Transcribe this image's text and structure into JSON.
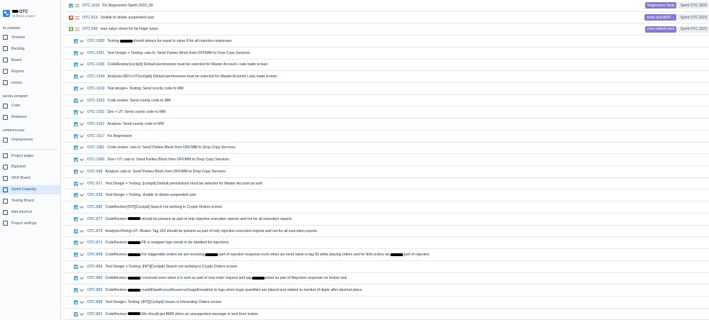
{
  "project": {
    "name": "OTC",
    "type": "Software project"
  },
  "sidebar": {
    "sections": {
      "planning": "PLANNING",
      "development": "DEVELOPMENT",
      "operations": "OPERATIONS"
    },
    "planning": [
      {
        "label": "Timeline",
        "icon": "timeline-icon"
      },
      {
        "label": "Backlog",
        "icon": "backlog-icon"
      },
      {
        "label": "Board",
        "icon": "board-icon"
      },
      {
        "label": "Reports",
        "icon": "reports-icon"
      },
      {
        "label": "Issues",
        "icon": "issues-icon"
      }
    ],
    "development": [
      {
        "label": "Code",
        "icon": "code-icon"
      },
      {
        "label": "Releases",
        "icon": "releases-icon"
      }
    ],
    "operations": [
      {
        "label": "Deployments",
        "icon": "deployments-icon"
      }
    ],
    "apps": [
      {
        "label": "Project pages",
        "icon": "pages-icon"
      },
      {
        "label": "BigGantt",
        "icon": "biggantt-icon"
      },
      {
        "label": "OKR Board",
        "icon": "okr-icon"
      },
      {
        "label": "Sprint Capacity",
        "icon": "capacity-icon",
        "active": true
      },
      {
        "label": "Testing Board",
        "icon": "testing-icon"
      },
      {
        "label": "Add shortcut",
        "icon": "add-icon"
      },
      {
        "label": "Project settings",
        "icon": "settings-icon"
      }
    ]
  },
  "issues": [
    {
      "type": "task",
      "key": "OTC-1016",
      "summary": "Fix Regression Sprint 2023_09",
      "label": "Regression Tests",
      "sprint": "Sprint OTC 2023"
    },
    {
      "type": "bug",
      "key": "OTC-913",
      "summary": "Unable to delete suspended user",
      "label": "trade and MDP ...",
      "sprint": "Sprint OTC 2023"
    },
    {
      "type": "story",
      "key": "OTC-246",
      "summary": "max value check for fat finger typos",
      "label": "core related work",
      "sprint": "Sprint OTC 2023"
    },
    {
      "type": "sub",
      "key": "OTC-1052",
      "summary_parts": [
        "Testing",
        "should always be equal to value 8 for all rejection responses."
      ]
    },
    {
      "type": "sub",
      "key": "OTC-1051",
      "summary": "Test Design + Testing: cats-ls: Send Parties Block from OFF/MM to Drop Copy Services"
    },
    {
      "type": "sub",
      "key": "OTC-1035",
      "summary": "CodeReview:[cockpit] Default permissions must be selected for Master Account i cats trade screen"
    },
    {
      "type": "sub",
      "key": "OTC-1034",
      "summary": "Analysis+DEV+UT:[cockpit] Default permissions must be selected for Master Account i cats trade screen"
    },
    {
      "type": "sub",
      "key": "OTC-1019",
      "summary": "Test design+ Testing: Send county code to MM"
    },
    {
      "type": "sub",
      "key": "OTC-1023",
      "summary": "Code review: Send county code to MM"
    },
    {
      "type": "sub",
      "key": "OTC-1022",
      "summary": "Dev + UT: Send county code to MM"
    },
    {
      "type": "sub",
      "key": "OTC-1021",
      "summary": "Analysis: Send county code to MM"
    },
    {
      "type": "sub",
      "key": "OTC-1017",
      "summary": "Fix Regression"
    },
    {
      "type": "sub",
      "key": "OTC-1001",
      "summary": "Code review: cats-ls: Send Parties Block from OFF/MM to Drop Copy Services"
    },
    {
      "type": "sub",
      "key": "OTC-1000",
      "summary": "Dev+ UT: cats-ls: Send Parties Block from OFF/MM to Drop Copy Services"
    },
    {
      "type": "sub",
      "key": "OTC-999",
      "summary": "Analysic cats-ls: Send Parties Block from OFF/MM to Drop Copy Services"
    },
    {
      "type": "sub",
      "key": "OTC-971",
      "summary": "Test Design + Testing: [cockpit] Default permissions must be selected for Master Account as well"
    },
    {
      "type": "sub",
      "key": "OTC-916",
      "summary": "Test Design + Testing: Unable to delete suspended user"
    },
    {
      "type": "sub",
      "key": "OTC-882",
      "summary": "CodeReview:[INT][Cockpit] Search not working in Crypto Orders screen"
    },
    {
      "type": "sub",
      "key": "OTC-877",
      "summary_parts": [
        "CodeReview:",
        "should be present as part of only rejection execution reports and not for all execution reports."
      ]
    },
    {
      "type": "sub",
      "key": "OTC-876",
      "summary": "Analysis+Fixing+UT--Bsdex: Tag 103 should be present as part of only rejection execution reports and not for all execution reports."
    },
    {
      "type": "sub",
      "key": "OTC-871",
      "summary_parts": [
        "CodeReview:",
        "PE in wrapper logs needs to be handled for rejections"
      ]
    },
    {
      "type": "sub",
      "key": "OTC-868",
      "summary_parts": [
        "CodeReview:",
        "For triggerable orders we are receiving",
        "part of rejection response even when we send value in tag 99 while placing orders and for limit orders we",
        "part of rejection"
      ]
    },
    {
      "type": "sub",
      "key": "OTC-866",
      "summary": "Test Design + Testing: [INT][Cockpit] Search not working in Crypto Orders screen"
    },
    {
      "type": "sub",
      "key": "OTC-865",
      "summary_parts": [
        "CodeReview:",
        "t received even when it is sent as part of new order request and tag",
        "eived as part of Rejection response on broker end ."
      ]
    },
    {
      "type": "sub",
      "key": "OTC-863",
      "summary_parts": [
        "CodeReview:",
        "nvalidDataAccessResourceUsageException in logs when huge quantities are placed and related to number of digits after decimal place."
      ]
    },
    {
      "type": "sub",
      "key": "OTC-858",
      "summary": "Test Design+ Testing: [INT][Cockpit] Issues in Interesting Orders screen"
    },
    {
      "type": "sub",
      "key": "OTC-851",
      "summary_parts": [
        "CodeReview:",
        "We should get BMR when an unsupported message is sent from broker."
      ]
    }
  ]
}
